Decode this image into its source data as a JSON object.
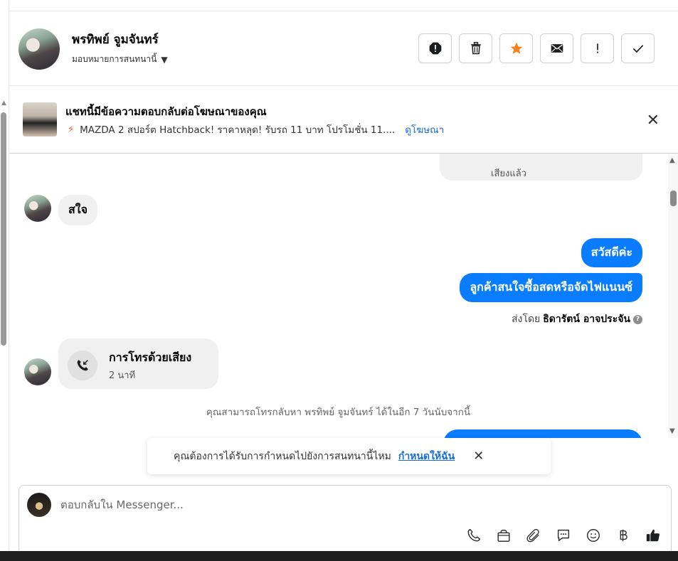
{
  "header": {
    "contact_name": "พรทิพย์ จูมจันทร์",
    "assign_label": "มอบหมายการสนทนานี้"
  },
  "ad": {
    "title": "แชทนี้มีข้อความตอบกลับต่อโฆษณาของคุณ",
    "subtitle": "MAZDA 2 สปอร์ต Hatchback! ราคาหลุด! รับรถ 11 บาท โปรโมชั่น 11....",
    "link": "ดูโฆษณา"
  },
  "messages": {
    "partial_top_text": "เสียงแล้ว",
    "incoming_1": "สใจ",
    "outgoing_1": "สวัสดีค่ะ",
    "outgoing_2": "ลูกค้าสนใจซื้อสดหรือจัดไฟแนนซ์",
    "sent_by_prefix": "ส่งโดย",
    "sent_by_name": "ธิดารัตน์ อาจประจัน",
    "call_title": "การโทรด้วยเสียง",
    "call_duration": "2 นาที",
    "callback_note": "คุณสามารถโทรกลับหา พรทิพย์ จูมจันทร์ ได้ในอีก 7 วันนับจากนี้"
  },
  "assign_toast": {
    "text": "คุณต้องการได้รับการกำหนดไปยังการสนทนานี้ไหม",
    "link": "กำหนดให้ฉัน"
  },
  "composer": {
    "placeholder": "ตอบกลับใน Messenger..."
  },
  "colors": {
    "accent": "#0a7cff",
    "star": "#f4821f",
    "link": "#1a6dd8"
  }
}
